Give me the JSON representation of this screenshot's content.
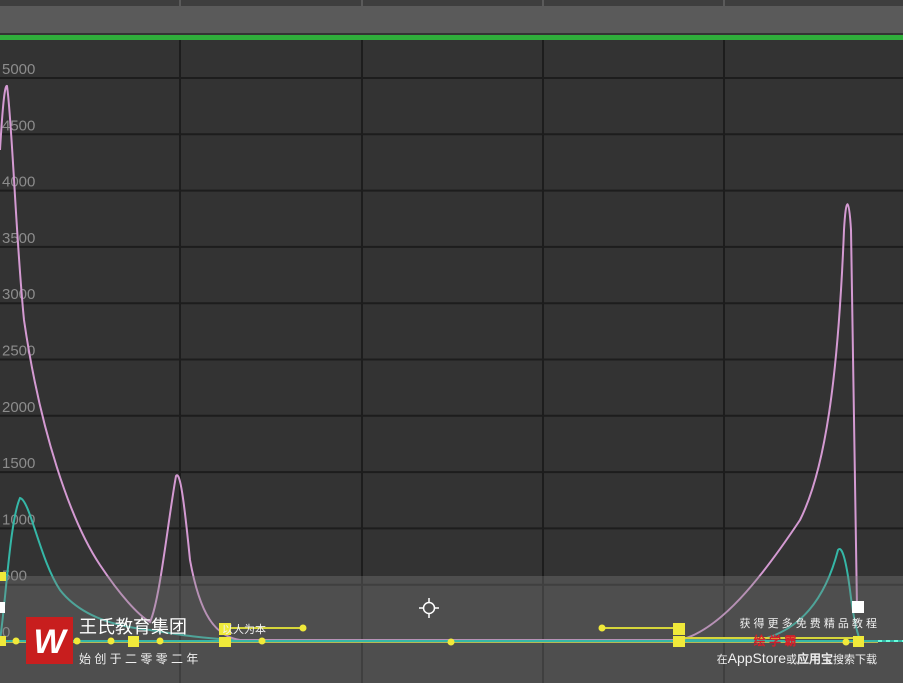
{
  "graph_editor": {
    "y_axis_labels": [
      "5000",
      "4500",
      "4000",
      "3500",
      "3000",
      "2500",
      "2000",
      "1500",
      "1000",
      "500",
      "0"
    ],
    "timeline_color": "#2fae3b",
    "background_color": "#333333",
    "grid_color": "#1d1d1d"
  },
  "curves": [
    {
      "name": "pink-curve",
      "color": "#d49ad2"
    },
    {
      "name": "teal-curve",
      "color": "#35b7a7"
    },
    {
      "name": "yellow-curve",
      "color": "#d6d63a"
    }
  ],
  "watermark": {
    "logo_text": "W",
    "group_name": "王氏教育集团",
    "slogan": "以人为本",
    "founded": "始 创 于 二 零 零 二 年",
    "promo_line": "获 得 更 多 免 费 精 品 教 程",
    "brand_name": "绘 学 霸",
    "download_prefix": "在",
    "download_app_store": "AppStore",
    "download_or": "或",
    "download_app_bao": "应用宝",
    "download_suffix": "搜索下载"
  }
}
